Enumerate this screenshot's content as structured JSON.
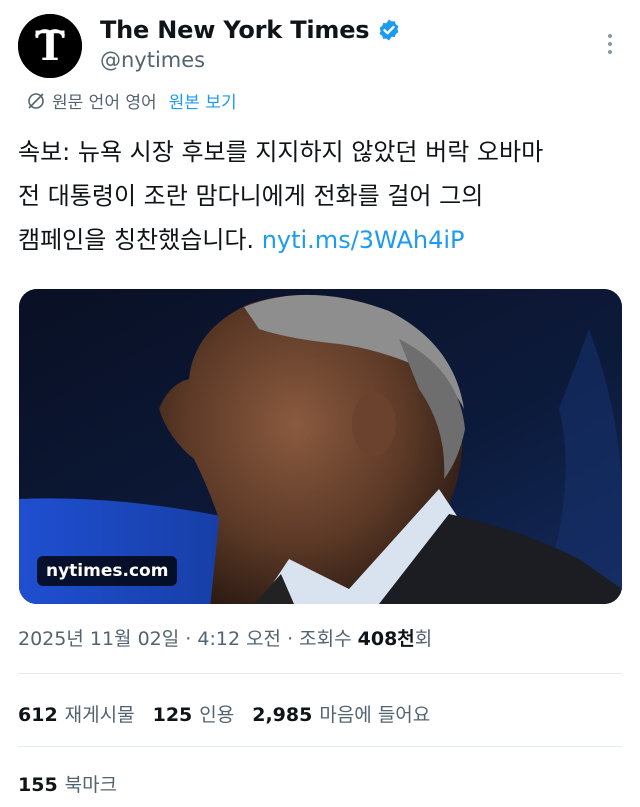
{
  "account": {
    "display_name": "The New York Times",
    "handle": "@nytimes"
  },
  "translation": {
    "label": "원문 언어 영어",
    "show_original": "원본 보기"
  },
  "tweet": {
    "line1": "속보: 뉴욕 시장 후보를 지지하지 않았던 버락 오바마",
    "line2": "전 대통령이 조란 맘다니에게 전화를 걸어 그의",
    "line3_text": "캠페인을 칭찬했습니다. ",
    "link": "nyti.ms/3WAh4iP"
  },
  "media": {
    "domain": "nytimes.com"
  },
  "meta": {
    "date": "2025년 11월 02일",
    "sep1": " · ",
    "time": "4:12 오전",
    "sep2": " · ",
    "views_label": "조회수 ",
    "views_num": "408천",
    "views_suffix": "회"
  },
  "stats": {
    "reposts_num": "612",
    "reposts_label": "재게시물",
    "quotes_num": "125",
    "quotes_label": "인용",
    "likes_num": "2,985",
    "likes_label": "마음에 들어요",
    "bookmarks_num": "155",
    "bookmarks_label": "북마크"
  },
  "colors": {
    "link": "#1d9bf0",
    "secondary_text": "#536471",
    "primary_text": "#0f1419",
    "verified": "#1d9bf0"
  },
  "icons": {
    "avatar": "nyt-logo-icon",
    "verified": "verified-badge-icon",
    "more": "more-vertical-icon",
    "translate": "globe-slash-icon"
  }
}
